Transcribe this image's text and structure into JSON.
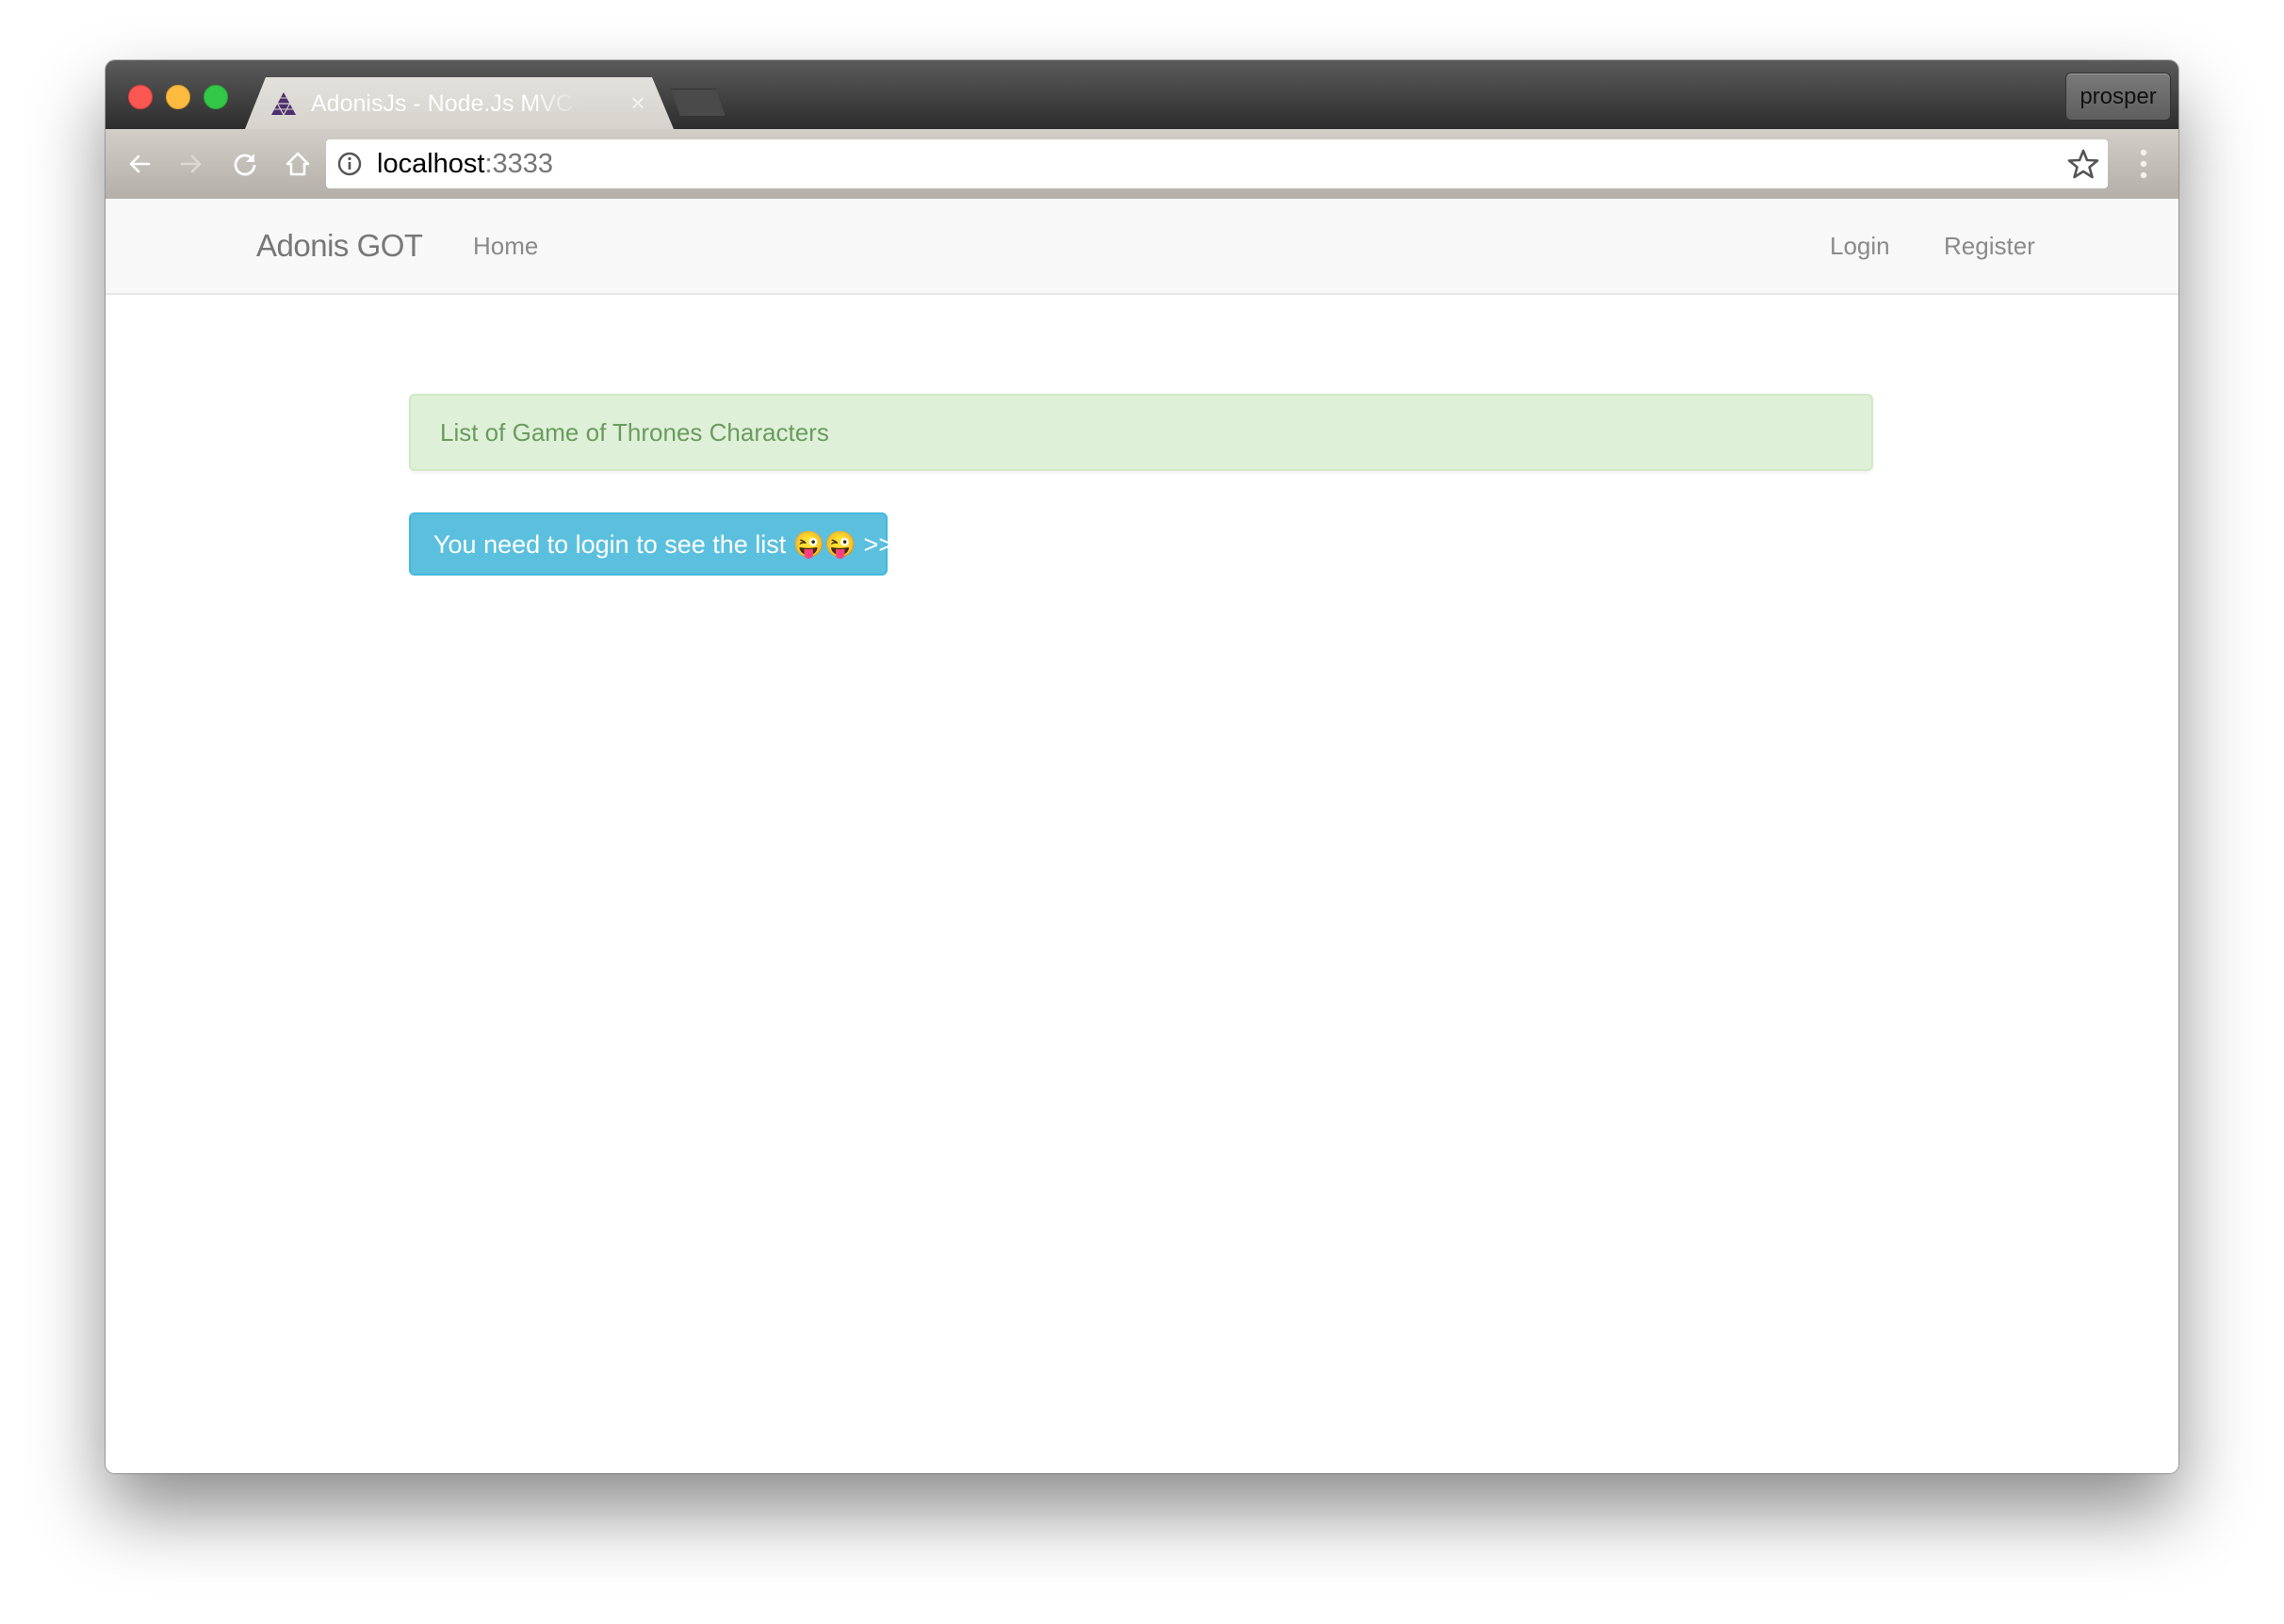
{
  "browser": {
    "tab": {
      "favicon": "adonisjs-logo-icon",
      "title": "AdonisJs - Node.Js MVC Framework",
      "close_label": "×"
    },
    "profile_name": "prosper",
    "url": {
      "host": "localhost",
      "port": ":3333"
    },
    "icons": {
      "back": "arrow-left-icon",
      "forward": "arrow-right-icon",
      "reload": "reload-icon",
      "home": "home-icon",
      "info": "info-icon",
      "bookmark": "star-icon",
      "menu": "kebab-menu-icon"
    },
    "traffic_lights": {
      "close": "#fc5753",
      "minimize": "#fdbc40",
      "zoom": "#33c748"
    }
  },
  "page": {
    "navbar": {
      "brand": "Adonis GOT",
      "left_links": [
        "Home"
      ],
      "right_links": [
        "Login",
        "Register"
      ]
    },
    "alert": {
      "text": "List of Game of Thrones Characters",
      "type": "success"
    },
    "login_button": {
      "label": "You need to login to see the list 😜😜 >>",
      "color": "#5bc0de"
    }
  }
}
